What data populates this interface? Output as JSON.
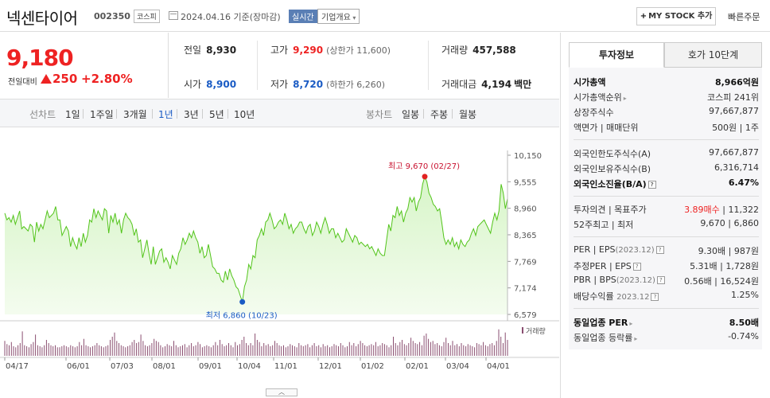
{
  "header": {
    "name": "넥센타이어",
    "code": "002350",
    "market": "코스피",
    "date": "2024.04.16 기준(장마감)",
    "realtime": "실시간",
    "company_info": "기업개요",
    "my_stock": "MY STOCK 추가",
    "my_stock_plus": "+",
    "quick_order": "빠른주문"
  },
  "price": {
    "current": "9,180",
    "change_label": "전일대비",
    "change": "250",
    "change_pct": "+2.80%",
    "direction": "up"
  },
  "stats": {
    "prev_close_label": "전일",
    "prev_close": "8,930",
    "open_label": "시가",
    "open": "8,900",
    "high_label": "고가",
    "high": "9,290",
    "upper_limit": "(상한가 11,600)",
    "low_label": "저가",
    "low": "8,720",
    "lower_limit": "(하한가 6,260)",
    "volume_label": "거래량",
    "volume": "457,588",
    "amount_label": "거래대금",
    "amount": "4,194",
    "amount_unit": "백만"
  },
  "period_bar": {
    "line_chart_label": "선차트",
    "line_periods": [
      "1일",
      "1주일",
      "3개월",
      "1년",
      "3년",
      "5년",
      "10년"
    ],
    "active_period": "1년",
    "candle_chart_label": "봉차트",
    "candle_periods": [
      "일봉",
      "주봉",
      "월봉"
    ]
  },
  "chart_data": {
    "type": "area",
    "title": "",
    "y_ticks": [
      "10,150",
      "9,555",
      "8,960",
      "8,365",
      "7,769",
      "7,174",
      "6,579"
    ],
    "ylim": [
      6579,
      10150
    ],
    "x_ticks": [
      "04/17",
      "06/01",
      "07/03",
      "08/01",
      "09/01",
      "10/04",
      "11/01",
      "12/01",
      "01/02",
      "02/01",
      "03/04",
      "04/01"
    ],
    "high_annotation": "최고 9,670 (02/27)",
    "low_annotation": "최저 6,860 (10/23)",
    "volume_label": "거래량",
    "series": [
      {
        "values": [
          8850,
          8700,
          8750,
          8650,
          8800,
          8600,
          8750,
          8900,
          8500,
          8550,
          8500,
          8450,
          8600,
          8550,
          8200,
          8650,
          8450,
          8600,
          8500,
          8700,
          8900,
          8750,
          8800,
          8850,
          9000,
          8700,
          8700,
          8350,
          8450,
          8550,
          8450,
          8100,
          8300,
          8150,
          8050,
          8300,
          8100,
          8400,
          8200,
          8350,
          8700,
          8650,
          8950,
          8750,
          8900,
          8800,
          8700,
          8950,
          8900,
          8400,
          8800,
          8650,
          8850,
          8600,
          8700,
          8400,
          8700,
          8850,
          8750,
          8700,
          8600,
          8350,
          8500,
          8200,
          8250,
          7850,
          8050,
          8250,
          7950,
          7700,
          8100,
          7700,
          7850,
          8000,
          8050,
          7750,
          7850,
          7750,
          7600,
          7900,
          7800,
          7700,
          7950,
          8050,
          8300,
          8150,
          8250,
          8400,
          8300,
          8450,
          8300,
          8200,
          7950,
          8100,
          7850,
          7900,
          8150,
          7900,
          7650,
          7600,
          7500,
          7500,
          7350,
          7300,
          7550,
          7350,
          7600,
          7450,
          7350,
          7200,
          7150,
          7000,
          6860,
          7200,
          7350,
          7700,
          7600,
          7900,
          7850,
          8250,
          8350,
          8500,
          8350,
          8650,
          8700,
          8850,
          8700,
          8500,
          8550,
          8650,
          8700,
          8600,
          8850,
          8700,
          8500,
          8600,
          8400,
          8500,
          8550,
          8650,
          8650,
          8500,
          8400,
          8550,
          8600,
          8350,
          8450,
          8650,
          8550,
          8400,
          8600,
          8750,
          8600,
          8400,
          8500,
          8500,
          8300,
          8400,
          8300,
          8200,
          8250,
          8500,
          8400,
          8300,
          8200,
          8350,
          8300,
          8150,
          8200,
          8150,
          8100,
          8150,
          8050,
          8100,
          8000,
          7900,
          8050,
          7950,
          7900,
          7900,
          8250,
          8600,
          8450,
          8800,
          8750,
          9000,
          8800,
          8900,
          8650,
          8850,
          8950,
          9200,
          9100,
          9200,
          8900,
          9100,
          9200,
          9500,
          9670,
          9550,
          9300,
          9200,
          9050,
          9000,
          8900,
          8950,
          8650,
          8300,
          8150,
          8250,
          8150,
          8300,
          8100,
          8200,
          8050,
          8250,
          8150,
          8100,
          8200,
          8250,
          8400,
          8500,
          8350,
          8550,
          8600,
          8650,
          8700,
          8600,
          8500,
          8400,
          8650,
          8850,
          8700,
          8900,
          9500,
          9300,
          8950,
          9180
        ]
      }
    ],
    "volume_series": [
      1.4,
      1.1,
      1.0,
      1.3,
      0.9,
      0.8,
      1.0,
      1.2,
      2.3,
      1.0,
      0.9,
      0.8,
      1.1,
      1.3,
      2.0,
      1.0,
      0.9,
      0.8,
      1.0,
      1.5,
      1.2,
      1.0,
      0.9,
      1.0,
      0.8,
      0.8,
      0.9,
      1.0,
      0.9,
      0.8,
      1.0,
      0.9,
      0.8,
      0.9,
      1.3,
      1.0,
      1.6,
      1.0,
      0.9,
      0.8,
      0.9,
      1.0,
      1.2,
      1.0,
      0.9,
      0.8,
      0.9,
      1.0,
      1.5,
      1.8,
      2.2,
      1.4,
      1.2,
      1.0,
      0.9,
      0.8,
      0.9,
      1.0,
      1.3,
      1.5,
      1.2,
      1.3,
      2.0,
      1.4,
      1.0,
      0.9,
      1.0,
      1.2,
      1.6,
      1.4,
      1.3,
      1.0,
      0.8,
      0.9,
      1.1,
      1.0,
      0.9,
      1.4,
      1.0,
      0.8,
      0.9,
      1.0,
      1.1,
      0.8,
      1.0,
      1.2,
      0.9,
      1.0,
      1.3,
      1.1,
      0.8,
      0.9,
      1.0,
      0.9,
      0.8,
      1.0,
      1.3,
      1.0,
      1.5,
      1.1,
      0.9,
      1.0,
      1.2,
      1.0,
      0.8,
      1.3,
      1.0,
      1.1,
      1.5,
      1.8,
      1.2,
      1.0,
      1.2,
      1.0,
      2.1,
      1.5,
      1.3,
      0.9,
      1.2,
      1.0,
      1.1,
      0.9,
      1.0,
      1.4,
      1.2,
      1.0,
      0.9,
      1.0,
      0.8,
      0.9,
      1.1,
      1.0,
      0.9,
      0.8,
      1.2,
      1.0,
      0.9,
      1.0,
      1.1,
      0.8,
      1.0,
      1.2,
      0.9,
      1.0,
      0.8,
      1.1,
      0.9,
      1.0,
      0.8,
      0.9,
      1.1,
      1.0,
      0.9,
      1.2,
      1.0,
      0.8,
      0.9,
      1.3,
      1.0,
      1.2,
      0.9,
      1.1,
      1.4,
      1.2,
      1.0,
      0.9,
      1.0,
      1.1,
      1.0,
      1.3,
      0.9,
      1.0,
      1.2,
      1.1,
      1.0,
      0.8,
      1.0,
      1.8,
      1.2,
      1.0,
      1.3,
      1.5,
      1.1,
      1.0,
      1.2,
      1.7,
      1.4,
      1.2,
      1.1,
      1.3,
      1.0,
      1.9,
      2.1,
      1.6,
      1.3,
      1.4,
      1.1,
      1.2,
      1.0,
      0.9,
      1.3,
      1.7,
      1.2,
      1.0,
      1.4,
      1.0,
      1.1,
      0.9,
      1.2,
      1.0,
      0.9,
      1.1,
      1.0,
      0.9,
      0.8,
      1.2,
      1.1,
      1.0,
      1.3,
      1.0,
      0.9,
      1.1,
      1.2,
      1.0,
      1.4,
      2.5,
      1.8,
      1.2,
      2.2,
      1.5
    ]
  },
  "right_panel": {
    "tab_active": "투자정보",
    "tab_other": "호가 10단계",
    "market_cap_label": "시가총액",
    "market_cap": "8,966억원",
    "market_cap_rank_label": "시가총액순위",
    "market_cap_rank": "코스피 241위",
    "shares_label": "상장주식수",
    "shares": "97,667,877",
    "par_label": "액면가 | 매매단위",
    "par": "500원 | 1주",
    "foreign_limit_label": "외국인한도주식수(A)",
    "foreign_limit": "97,667,877",
    "foreign_hold_label": "외국인보유주식수(B)",
    "foreign_hold": "6,316,714",
    "foreign_ratio_label": "외국인소진율(B/A)",
    "foreign_ratio": "6.47%",
    "opinion_label": "투자의견 | 목표주가",
    "opinion": "3.89매수",
    "target": "11,322",
    "week52_label": "52주최고 | 최저",
    "week52": "9,670 | 6,860",
    "per_label": "PER | EPS",
    "per_period": "(2023.12)",
    "per": "9.30배 | 987원",
    "eper_label": "추정PER | EPS",
    "eper": "5.31배 | 1,728원",
    "pbr_label": "PBR | BPS",
    "pbr_period": "(2023.12)",
    "pbr": "0.56배 | 16,524원",
    "div_label": "배당수익률",
    "div_period": "2023.12",
    "div": "1.25%",
    "sector_per_label": "동일업종 PER",
    "sector_per": "8.50배",
    "sector_chg_label": "동일업종 등락률",
    "sector_chg": "-0.74%"
  },
  "colors": {
    "up": "#e22222",
    "down": "#1a5bc4",
    "area_line": "#52c41a",
    "area_fill": "#d7f5c8"
  }
}
